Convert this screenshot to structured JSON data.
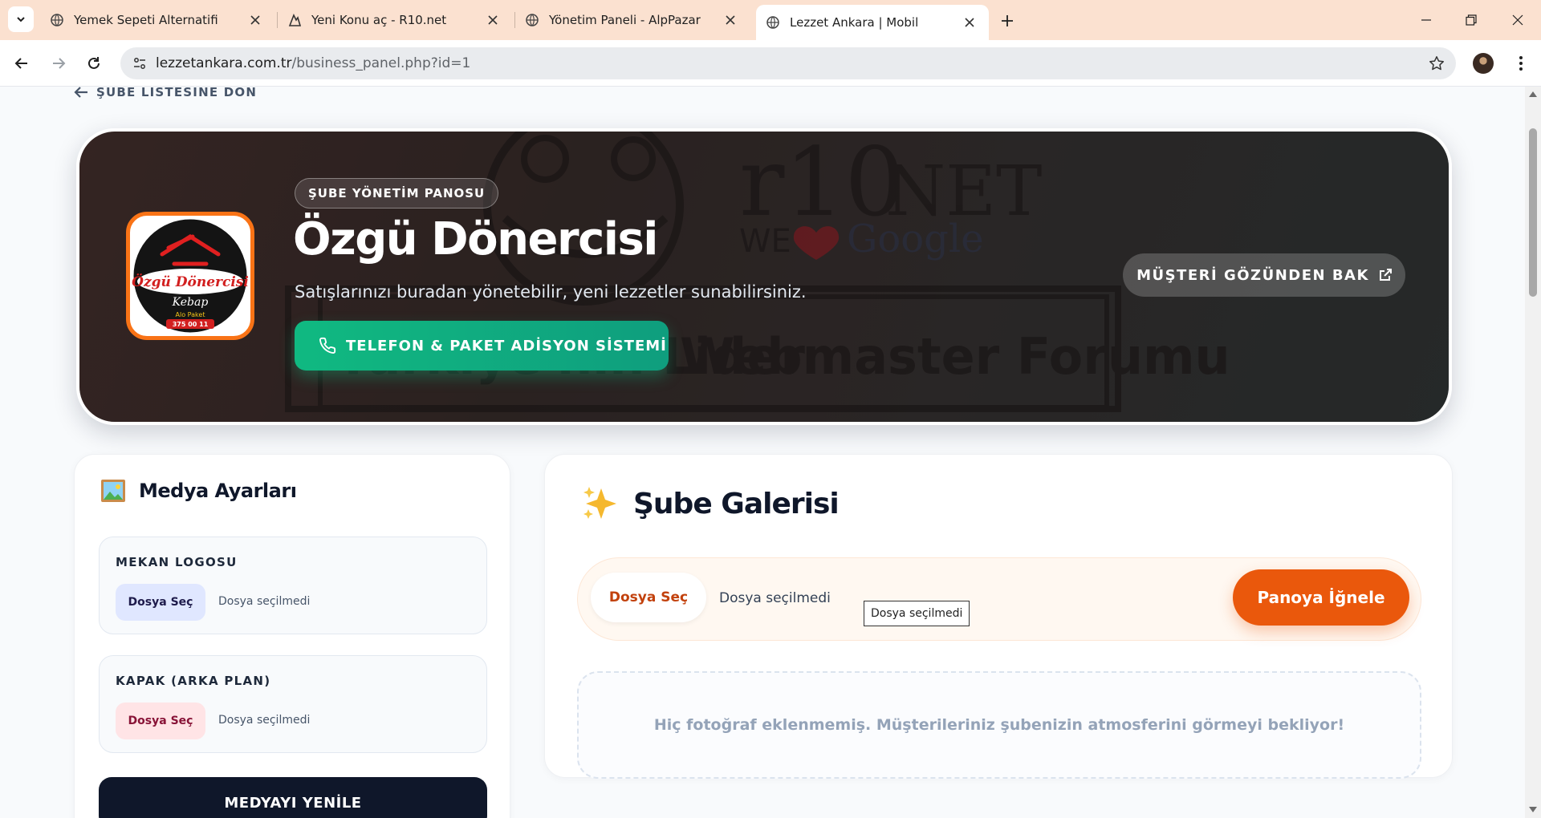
{
  "browser": {
    "tabs": [
      {
        "title": "Yemek Sepeti Alternatifi",
        "icon": "globe-icon",
        "active": false
      },
      {
        "title": "Yeni Konu aç - R10.net",
        "icon": "r10-icon",
        "active": false
      },
      {
        "title": "Yönetim Paneli - AlpPazar",
        "icon": "globe-icon",
        "active": false
      },
      {
        "title": "Lezzet Ankara | Mobil",
        "icon": "globe-icon",
        "active": true
      }
    ],
    "url_host": "lezzetankara.com.tr",
    "url_path": "/business_panel.php?id=1",
    "tabbar_color": "#fbe1d0"
  },
  "page": {
    "back_link": "ŞUBE LİSTESİNE DÖN",
    "hero": {
      "badge": "ŞUBE YÖNETİM PANOSU",
      "title": "Özgü Dönercisi",
      "subtitle": "Satışlarınızı buradan yönetebilir, yeni lezzetler sunabilirsiniz.",
      "phone_button": "TELEFON & PAKET ADİSYON SİSTEMİ",
      "view_button": "MÜŞTERİ GÖZÜNDEN BAK",
      "logo": {
        "line1": "Özgü Dönercisi",
        "line2": "Kebap",
        "line3": "Alo Paket",
        "phone": "375 00 11"
      },
      "cover_texts": {
        "brand": "r10",
        "brand_suffix": "NET",
        "tagline_we": "WE",
        "tagline_google": "Google",
        "banner": "Webmaster Forumu",
        "banner_prefix": "Türkiye'nin Lider"
      }
    },
    "media": {
      "title": "Medya Ayarları",
      "icon": "picture-icon",
      "logo_label": "MEKAN LOGOSU",
      "logo_button": "Dosya Seç",
      "logo_file": "Dosya seçilmedi",
      "cover_label": "KAPAK (ARKA PLAN)",
      "cover_button": "Dosya Seç",
      "cover_file": "Dosya seçilmedi",
      "refresh_button": "MEDYAYI YENİLE"
    },
    "gallery": {
      "title": "Şube Galerisi",
      "icon": "sparkles-icon",
      "file_button": "Dosya Seç",
      "file_text": "Dosya seçilmedi",
      "tooltip": "Dosya seçilmedi",
      "pin_button": "Panoya İğnele",
      "empty_text": "Hiç fotoğraf eklenmemiş. Müşterileriniz şubenizin atmosferini görmeyi bekliyor!"
    },
    "colors": {
      "accent_orange": "#ea580c",
      "accent_green": "#10b981",
      "dark": "#0f172a"
    }
  }
}
